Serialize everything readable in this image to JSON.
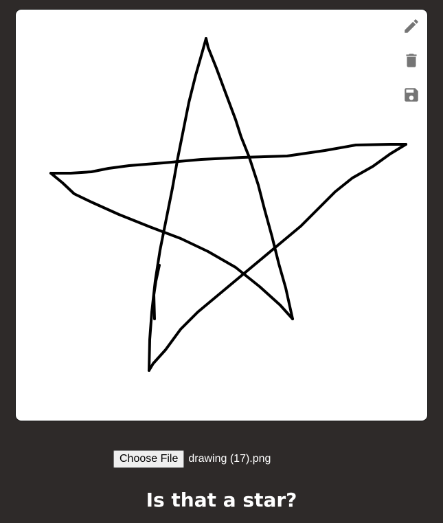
{
  "toolbar": {
    "icons": [
      "pencil-icon",
      "trash-icon",
      "save-icon"
    ],
    "icon_color": "#757575"
  },
  "file_input": {
    "button_label": "Choose File",
    "file_name": "drawing (17).png"
  },
  "question": "Is that a star?",
  "colors": {
    "background": "#2e2a29",
    "canvas": "#ffffff",
    "stroke": "#000000"
  }
}
